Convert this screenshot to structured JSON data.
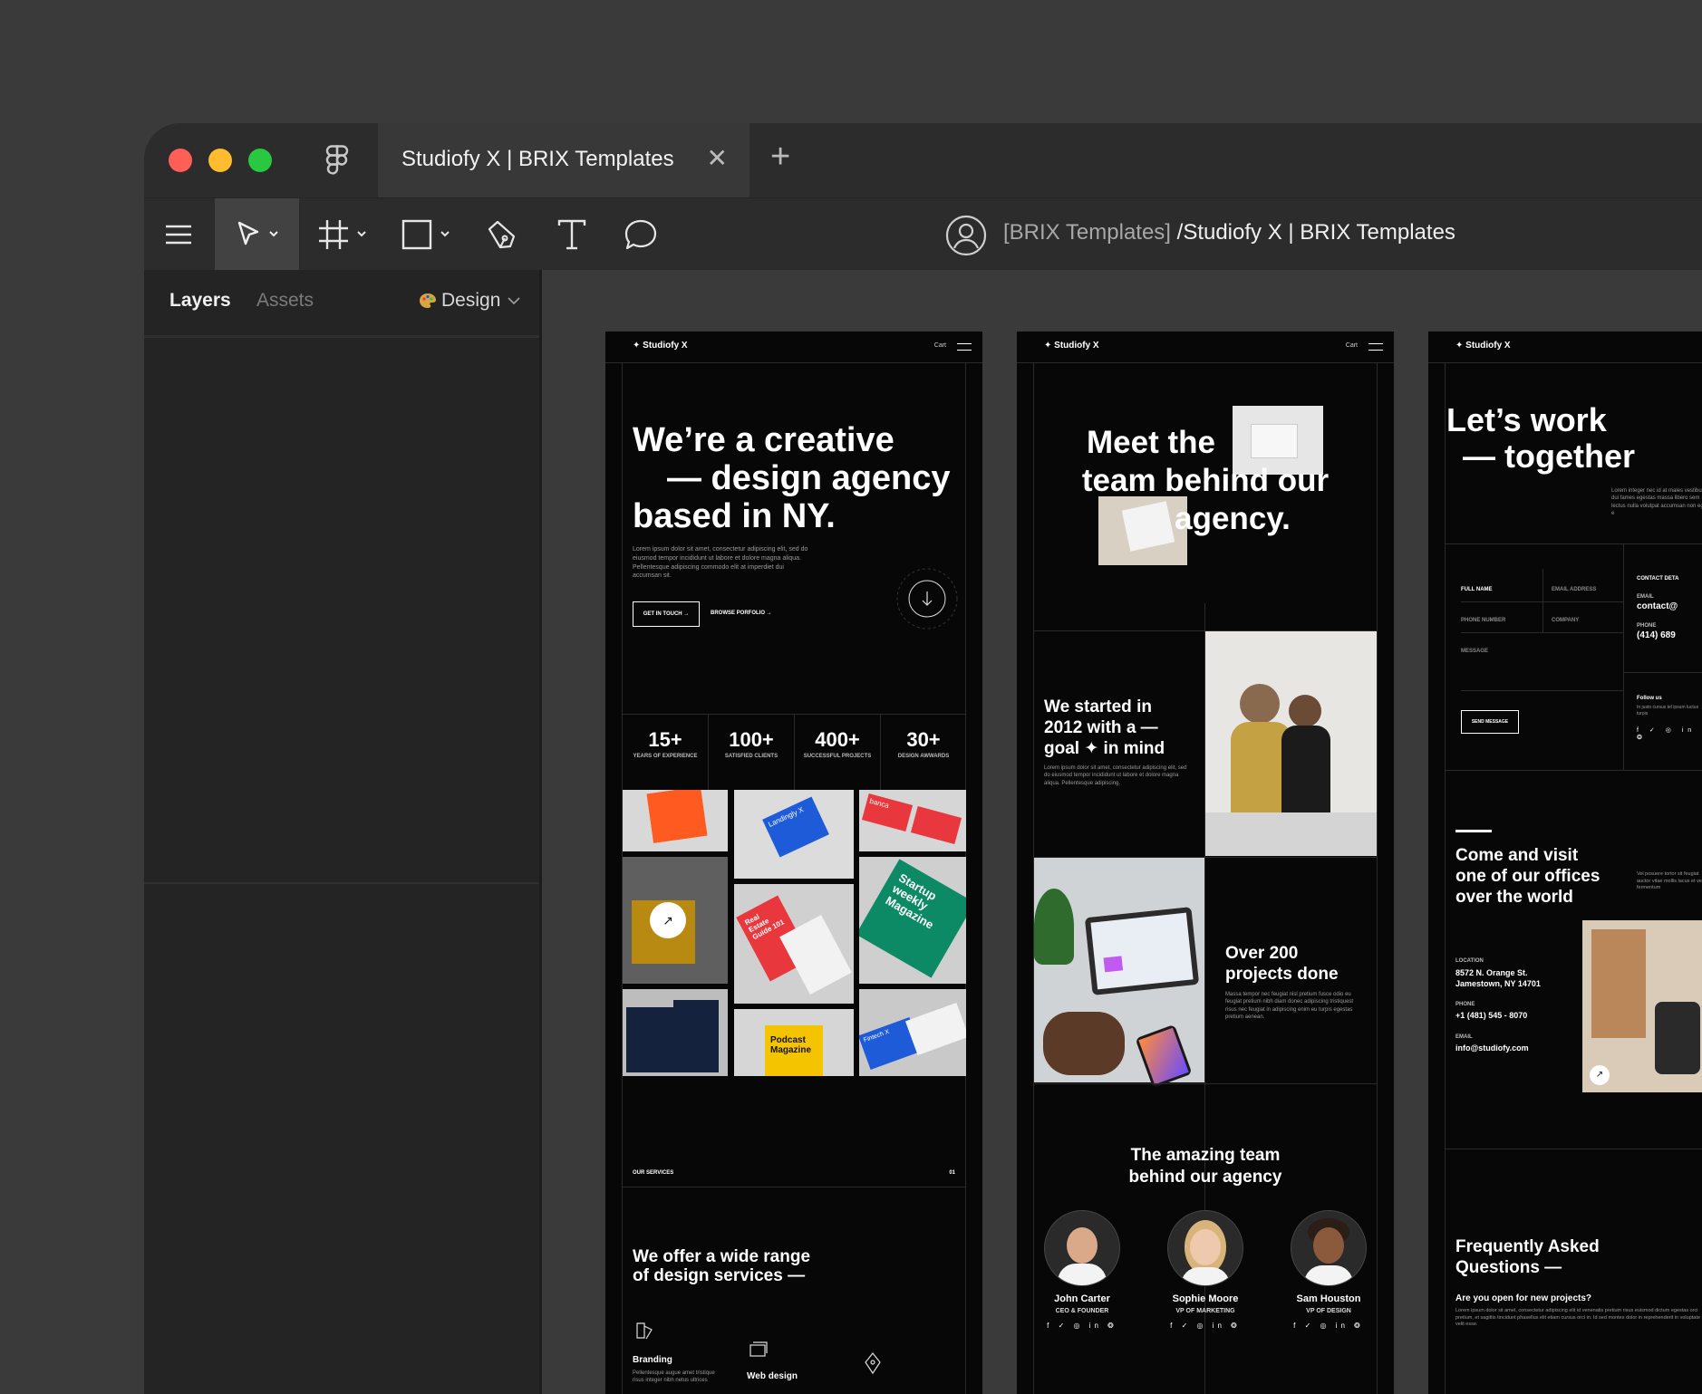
{
  "window": {
    "tab_title": "Studiofy X | BRIX Templates",
    "tab_close": "✕",
    "tab_add": "+",
    "breadcrumb_team": "[BRIX Templates]",
    "breadcrumb_sep": " /",
    "breadcrumb_file": "Studiofy X | BRIX Templates"
  },
  "sidebar": {
    "layers_label": "Layers",
    "assets_label": "Assets",
    "design_label": "Design"
  },
  "frame1": {
    "logo": "✦ Studiofy X",
    "cart": "Cart",
    "hero_line1": "We’re a creative",
    "hero_line2": "— design agency",
    "hero_line3": "based in NY.",
    "hero_body": "Lorem ipsum dolor sit amet, consectetur adipiscing elit, sed do eiusmod tempor incididunt ut labore et dolore magna aliqua. Pellentesque adipiscing commodo elit at imperdiet dui accumsan sit.",
    "btn_contact": "GET IN TOUCH →",
    "btn_portfolio": "BROWSE PORFOLIO →",
    "scroll_label": "SCROLL DOWN",
    "stats": [
      {
        "n": "15+",
        "l": "YEARS OF EXPERIENCE"
      },
      {
        "n": "100+",
        "l": "SATISFIED CLIENTS"
      },
      {
        "n": "400+",
        "l": "SUCCESSFUL PROJECTS"
      },
      {
        "n": "30+",
        "l": "DESIGN AWWARDS"
      }
    ],
    "tiles": {
      "landingly": "Landingly X",
      "banca": "banca",
      "startup": "Startup weekly Magazine",
      "realestate": "Real Estate Guide 101",
      "podcast": "Podcast Magazine",
      "fintech": "Fintech X"
    },
    "services_label": "OUR SERVICES",
    "services_num": "01",
    "services_title1": "We offer a wide range",
    "services_title2": "of design services —",
    "service1": "Branding",
    "service1_body": "Pellentesque augue amet tristique risus integer nibh netus ultrices",
    "service2": "Web design"
  },
  "frame2": {
    "logo": "✦ Studiofy X",
    "cart": "Cart",
    "hero_line1": "Meet the",
    "hero_line2": "team behind our",
    "hero_line3": "agency.",
    "started_line1": "We started in",
    "started_line2": "2012 with a —",
    "started_line3": "goal ✦ in mind",
    "started_body": "Lorem ipsum dolor sit amet, consectetur adipiscing elit, sed do eiusmod tempor incididunt ut labore et dolore magna aliqua. Pellentesque adipiscing.",
    "projects_line1": "Over 200",
    "projects_line2": "projects done",
    "projects_body": "Massa tempor nec feugiat nisl pretium fusce odio eu feugiat pretium nibh diam donec adipiscing tristiquest risus nec feugiat in adipiscing enim eu turpis egestas pretium aenean.",
    "team_title1": "The amazing team",
    "team_title2": "behind our agency",
    "members": [
      {
        "name": "John Carter",
        "role": "CEO & FOUNDER"
      },
      {
        "name": "Sophie Moore",
        "role": "VP OF MARKETING"
      },
      {
        "name": "Sam Houston",
        "role": "VP OF DESIGN"
      }
    ],
    "social": "f ✓ ◎ in ❂"
  },
  "frame3": {
    "logo": "✦ Studiofy X",
    "hero_line1": "Let’s work",
    "hero_line2": "— together",
    "hero_body": "Lorem integer nec id at males vestibulum dui fames egestas massa libero sem lectus nulla volutpat accumsan non eget e",
    "full_name": "FULL NAME",
    "email_address": "EMAIL ADDRESS",
    "phone_number": "PHONE NUMBER",
    "company": "COMPANY",
    "message": "MESSAGE",
    "send": "SEND MESSAGE",
    "contact_details": "CONTACT DETA",
    "email_label": "EMAIL",
    "email_value": "contact@",
    "phone_label": "PHONE",
    "phone_value": "(414) 689",
    "follow": "Follow us",
    "follow_body": "In justo cursus tel ipsum luctus turpis",
    "visit_line1": "Come and visit",
    "visit_line2": "one of our offices",
    "visit_line3": "over the world",
    "visit_side": "Vel posuere tortor sit feugiat auctor vitae mollis lacus et vel fermentum",
    "location_label": "LOCATION",
    "location_value1": "8572 N. Orange St.",
    "location_value2": "Jamestown, NY 14701",
    "phone2_label": "PHONE",
    "phone2_value": "+1 (481) 545 - 8070",
    "email2_label": "EMAIL",
    "email2_value": "info@studiofy.com",
    "faq_line1": "Frequently Asked",
    "faq_line2": "Questions —",
    "faq_q1": "Are you open for new projects?",
    "faq_a1": "Lorem ipsum dolor sit amet, consectetur adipiscing elit id venenatis pretium risus euismod dictum egestas orci pretium, et sagittis tincidunt phasellus elit etiam cursus orci in. Id sed montes dolor in reprehenderit in voluptate velit esse."
  },
  "colors": {
    "close": "#ff5f57",
    "minimize": "#febc2e",
    "zoom": "#28c840",
    "accent_orange": "#ff5a1f",
    "accent_blue": "#1e5bd8",
    "accent_green": "#0c8a66",
    "accent_yellow": "#f5c400",
    "accent_red": "#e8383d"
  }
}
